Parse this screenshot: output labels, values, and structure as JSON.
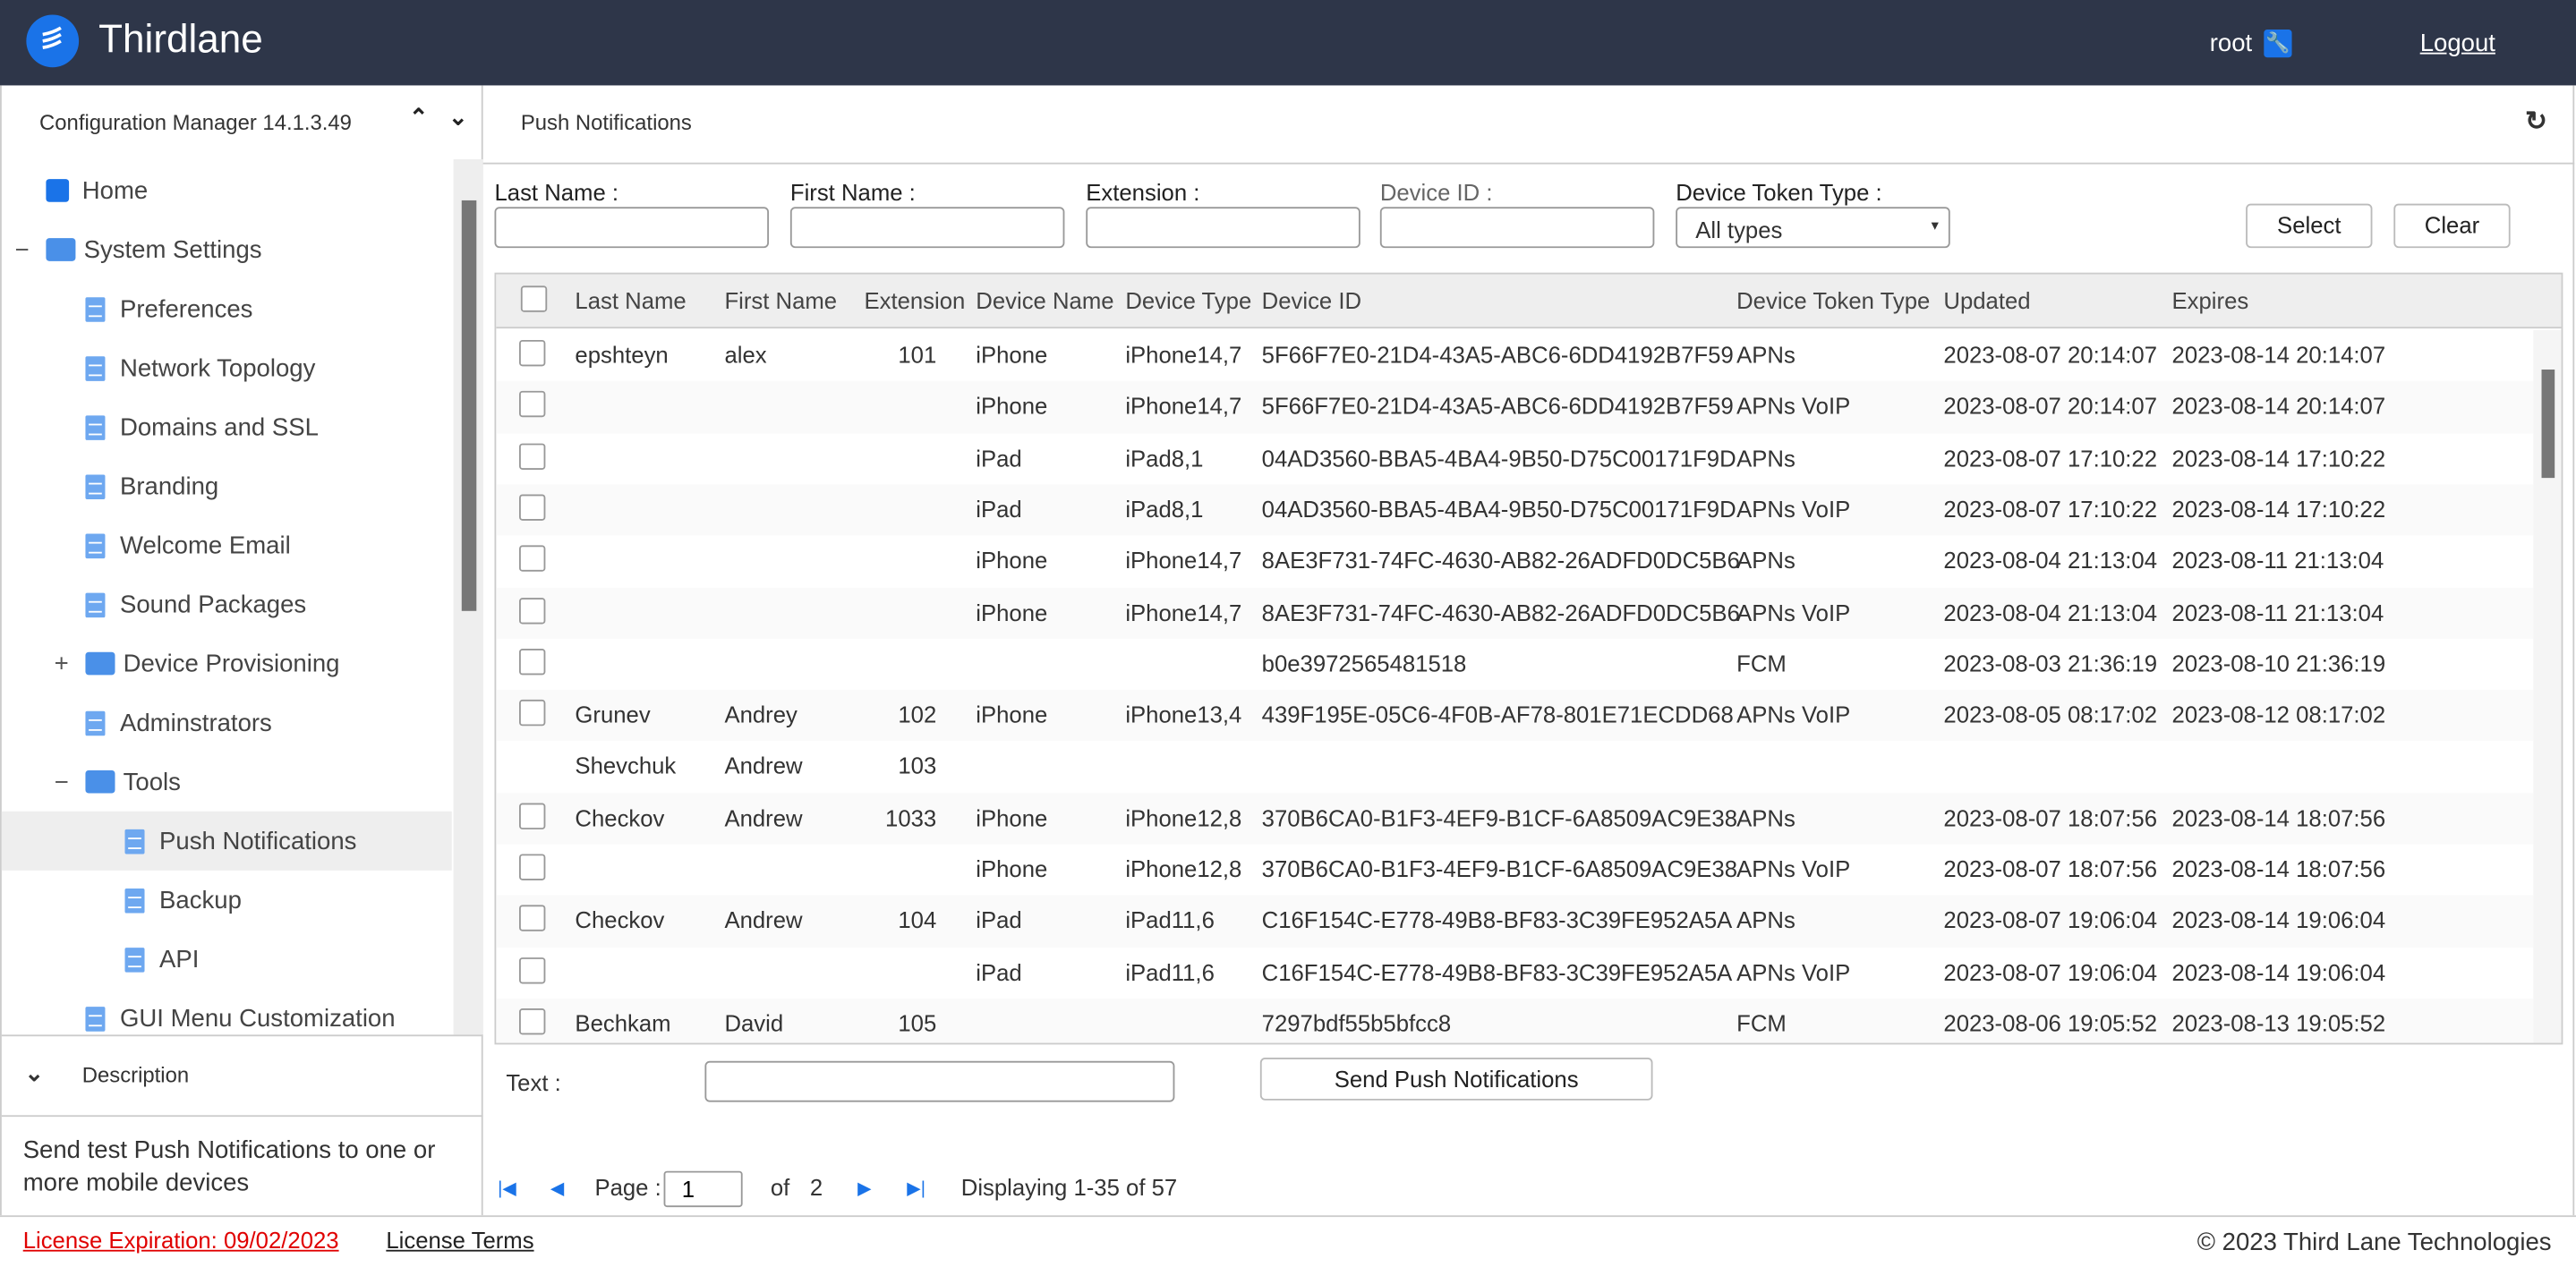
{
  "header": {
    "brand": "Thirdlane",
    "user": "root",
    "logout": "Logout",
    "accent": "#1a73e8",
    "bg": "#2e3649"
  },
  "sidebar": {
    "title": "Configuration Manager 14.1.3.49",
    "items": [
      {
        "label": "Home",
        "icon": "home-chart-icon",
        "level": 0
      },
      {
        "label": "System Settings",
        "icon": "folder-icon",
        "level": 0,
        "toggle": "−"
      },
      {
        "label": "Preferences",
        "icon": "document-icon",
        "level": 1
      },
      {
        "label": "Network Topology",
        "icon": "document-icon",
        "level": 1
      },
      {
        "label": "Domains and SSL",
        "icon": "document-icon",
        "level": 1
      },
      {
        "label": "Branding",
        "icon": "document-icon",
        "level": 1
      },
      {
        "label": "Welcome Email",
        "icon": "document-icon",
        "level": 1
      },
      {
        "label": "Sound Packages",
        "icon": "document-icon",
        "level": 1
      },
      {
        "label": "Device Provisioning",
        "icon": "folder-icon",
        "level": 1,
        "toggle": "+"
      },
      {
        "label": "Adminstrators",
        "icon": "document-icon",
        "level": 1
      },
      {
        "label": "Tools",
        "icon": "folder-icon",
        "level": 1,
        "toggle": "−"
      },
      {
        "label": "Push Notifications",
        "icon": "document-icon",
        "level": 2,
        "selected": true
      },
      {
        "label": "Backup",
        "icon": "document-icon",
        "level": 2
      },
      {
        "label": "API",
        "icon": "document-icon",
        "level": 2
      },
      {
        "label": "GUI Menu Customization",
        "icon": "document-icon",
        "level": 1
      }
    ],
    "description_title": "Description",
    "description": "Send test Push Notifications to one or more mobile devices"
  },
  "main": {
    "title": "Push Notifications",
    "filters": {
      "last_name": "Last Name :",
      "first_name": "First Name :",
      "extension": "Extension :",
      "device_id": "Device ID :",
      "token_type": "Device Token Type :",
      "token_type_value": "All types",
      "select": "Select",
      "clear": "Clear"
    },
    "table": {
      "columns": [
        "Last Name",
        "First Name",
        "Extension",
        "Device Name",
        "Device Type",
        "Device ID",
        "Device Token Type",
        "Updated",
        "Expires"
      ],
      "rows": [
        {
          "cb": true,
          "c": [
            "epshteyn",
            "alex",
            "101",
            "iPhone",
            "iPhone14,7",
            "5F66F7E0-21D4-43A5-ABC6-6DD4192B7F59",
            "APNs",
            "2023-08-07 20:14:07",
            "2023-08-14 20:14:07"
          ]
        },
        {
          "cb": true,
          "c": [
            "",
            "",
            "",
            "iPhone",
            "iPhone14,7",
            "5F66F7E0-21D4-43A5-ABC6-6DD4192B7F59",
            "APNs VoIP",
            "2023-08-07 20:14:07",
            "2023-08-14 20:14:07"
          ]
        },
        {
          "cb": true,
          "c": [
            "",
            "",
            "",
            "iPad",
            "iPad8,1",
            "04AD3560-BBA5-4BA4-9B50-D75C00171F9D",
            "APNs",
            "2023-08-07 17:10:22",
            "2023-08-14 17:10:22"
          ]
        },
        {
          "cb": true,
          "c": [
            "",
            "",
            "",
            "iPad",
            "iPad8,1",
            "04AD3560-BBA5-4BA4-9B50-D75C00171F9D",
            "APNs VoIP",
            "2023-08-07 17:10:22",
            "2023-08-14 17:10:22"
          ]
        },
        {
          "cb": true,
          "c": [
            "",
            "",
            "",
            "iPhone",
            "iPhone14,7",
            "8AE3F731-74FC-4630-AB82-26ADFD0DC5B6",
            "APNs",
            "2023-08-04 21:13:04",
            "2023-08-11 21:13:04"
          ]
        },
        {
          "cb": true,
          "c": [
            "",
            "",
            "",
            "iPhone",
            "iPhone14,7",
            "8AE3F731-74FC-4630-AB82-26ADFD0DC5B6",
            "APNs VoIP",
            "2023-08-04 21:13:04",
            "2023-08-11 21:13:04"
          ]
        },
        {
          "cb": true,
          "c": [
            "",
            "",
            "",
            "",
            "",
            "b0e3972565481518",
            "FCM",
            "2023-08-03 21:36:19",
            "2023-08-10 21:36:19"
          ]
        },
        {
          "cb": true,
          "c": [
            "Grunev",
            "Andrey",
            "102",
            "iPhone",
            "iPhone13,4",
            "439F195E-05C6-4F0B-AF78-801E71ECDD68",
            "APNs VoIP",
            "2023-08-05 08:17:02",
            "2023-08-12 08:17:02"
          ]
        },
        {
          "cb": false,
          "c": [
            "Shevchuk",
            "Andrew",
            "103",
            "",
            "",
            "",
            "",
            "",
            ""
          ]
        },
        {
          "cb": true,
          "c": [
            "Checkov",
            "Andrew",
            "1033",
            "iPhone",
            "iPhone12,8",
            "370B6CA0-B1F3-4EF9-B1CF-6A8509AC9E38",
            "APNs",
            "2023-08-07 18:07:56",
            "2023-08-14 18:07:56"
          ]
        },
        {
          "cb": true,
          "c": [
            "",
            "",
            "",
            "iPhone",
            "iPhone12,8",
            "370B6CA0-B1F3-4EF9-B1CF-6A8509AC9E38",
            "APNs VoIP",
            "2023-08-07 18:07:56",
            "2023-08-14 18:07:56"
          ]
        },
        {
          "cb": true,
          "c": [
            "Checkov",
            "Andrew",
            "104",
            "iPad",
            "iPad11,6",
            "C16F154C-E778-49B8-BF83-3C39FE952A5A",
            "APNs",
            "2023-08-07 19:06:04",
            "2023-08-14 19:06:04"
          ]
        },
        {
          "cb": true,
          "c": [
            "",
            "",
            "",
            "iPad",
            "iPad11,6",
            "C16F154C-E778-49B8-BF83-3C39FE952A5A",
            "APNs VoIP",
            "2023-08-07 19:06:04",
            "2023-08-14 19:06:04"
          ]
        },
        {
          "cb": true,
          "c": [
            "Bechkam",
            "David",
            "105",
            "",
            "",
            "7297bdf55b5bfcc8",
            "FCM",
            "2023-08-06 19:05:52",
            "2023-08-13 19:05:52"
          ]
        }
      ]
    },
    "text_label": "Text :",
    "send_button": "Send Push Notifications",
    "pager": {
      "page_label": "Page :",
      "page": "1",
      "of": "of",
      "total_pages": "2",
      "displaying": "Displaying 1-35 of 57"
    }
  },
  "footer": {
    "license": "License Expiration: 09/02/2023",
    "terms": "License Terms",
    "copyright": "© 2023 Third Lane Technologies",
    "license_color": "#e00000"
  }
}
